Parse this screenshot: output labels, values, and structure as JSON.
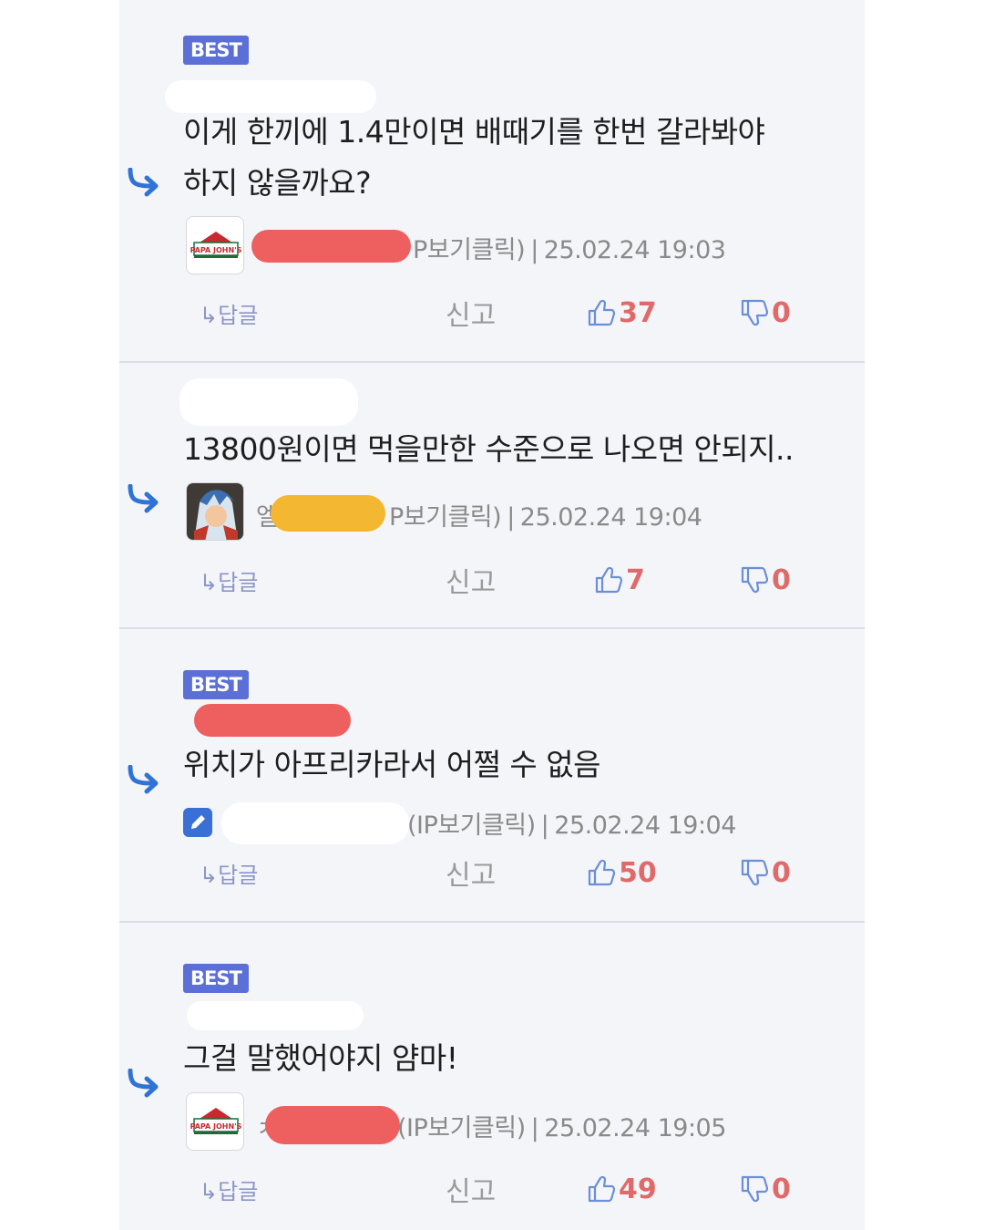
{
  "comments": [
    {
      "best": "BEST",
      "text_line1": "이게 한끼에 1.4만이면 배때기를 한번 갈라봐야",
      "text_line2": "하지 않을까요?",
      "meta_suffix": "P보기클릭)",
      "timestamp": "25.02.24 19:03",
      "reply_label": "↳답글",
      "report_label": "신고",
      "likes": "37",
      "dislikes": "0",
      "avatar": "papa-johns-logo",
      "avatar_text": "PAPA JOHN'S",
      "redact_color": "#ee6060"
    },
    {
      "text_line1": "13800원이면 먹을만한 수준으로 나오면 안되지..",
      "name_prefix": "엘",
      "meta_suffix": "P보기클릭)",
      "timestamp": "25.02.24 19:04",
      "reply_label": "↳답글",
      "report_label": "신고",
      "likes": "7",
      "dislikes": "0",
      "avatar": "anime-character-avatar",
      "redact_color": "#f4b731"
    },
    {
      "best": "BEST",
      "text_line1": "위치가 아프리카라서 어쩔 수 없음",
      "meta_suffix": "(IP보기클릭)",
      "timestamp": "25.02.24 19:04",
      "reply_label": "↳답글",
      "report_label": "신고",
      "likes": "50",
      "dislikes": "0",
      "avatar": "pencil-icon",
      "redact_color": "#ee6060"
    },
    {
      "best": "BEST",
      "text_line1": "그걸 말했어야지 얌마!",
      "name_prefix": "ㅊ",
      "meta_suffix": "(IP보기클릭)",
      "timestamp": "25.02.24 19:05",
      "reply_label": "↳답글",
      "report_label": "신고",
      "likes": "49",
      "dislikes": "0",
      "avatar": "papa-johns-logo",
      "avatar_text": "PAPA JOHN'S",
      "redact_color": "#ee6060"
    }
  ],
  "colors": {
    "best_badge": "#5b6fd6",
    "reply_arrow": "#2f73d6",
    "vote_count": "#e06a6a",
    "background": "#f4f5f9"
  }
}
